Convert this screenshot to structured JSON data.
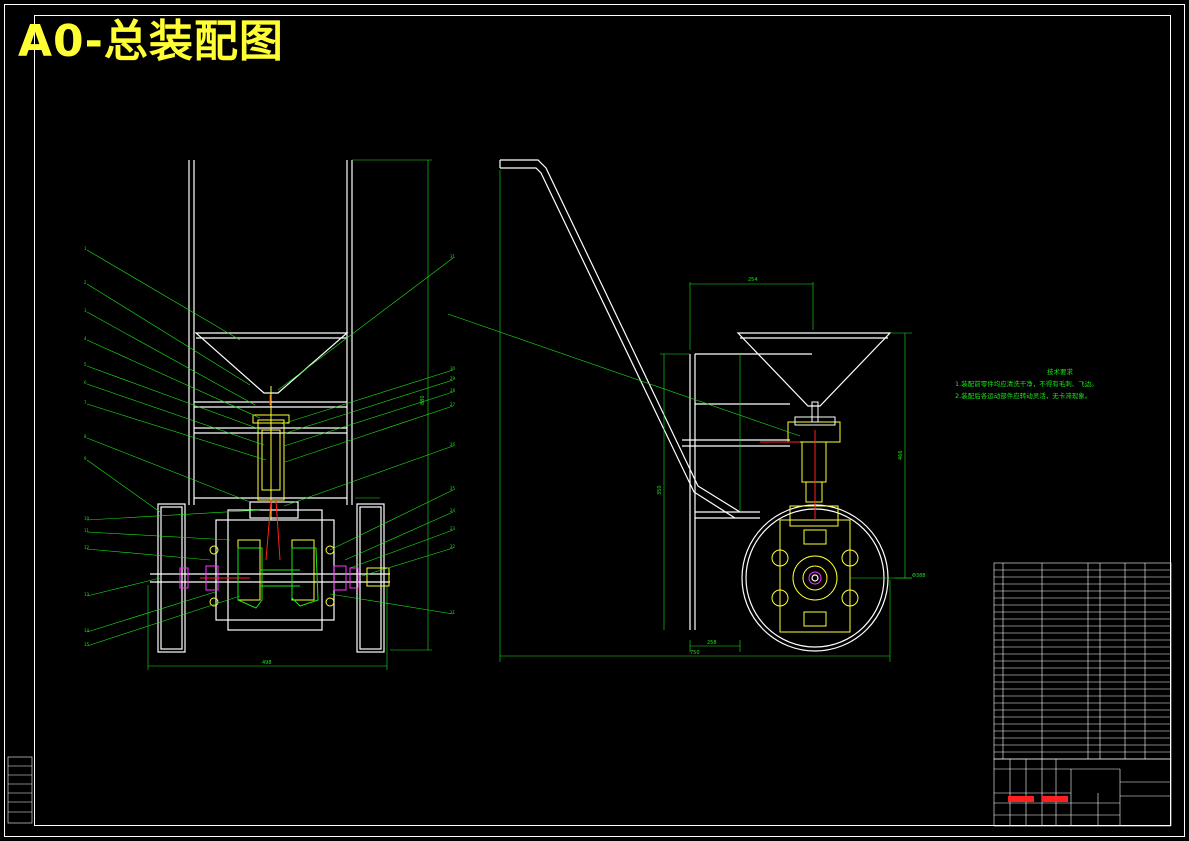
{
  "title": "A0-总装配图",
  "tech_notes": {
    "heading": "技术要求",
    "lines": [
      "1.装配前零件均应清洗干净，不得有毛刺、飞边。",
      "2.装配后各运动部件应转动灵活，无卡滞现象。"
    ]
  },
  "dimensions": {
    "front_width": "498",
    "front_height": "880",
    "side_width": "750",
    "side_top": "254",
    "side_bottom": "258",
    "wheel_dia": "Φ388",
    "side_height": "466",
    "frame_height": "350"
  },
  "colors": {
    "background": "#000000",
    "frame": "#ffffff",
    "title": "#ffff33",
    "leader": "#19e619",
    "red": "#ff2020",
    "magenta": "#ff33ff",
    "yellow": "#ffff33",
    "cyan": "#33ffff"
  }
}
